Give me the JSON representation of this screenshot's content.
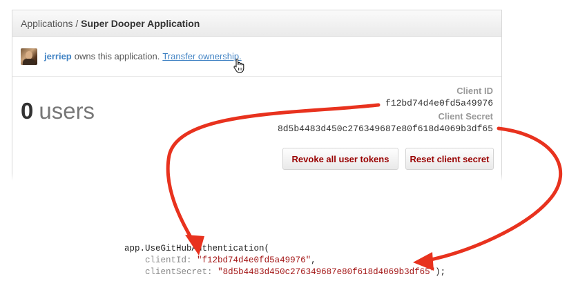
{
  "breadcrumb": {
    "parent": "Applications",
    "separator": "/",
    "current": "Super Dooper Application"
  },
  "owner": {
    "username": "jerriep",
    "text": "owns this application.",
    "link": "Transfer ownership."
  },
  "stats": {
    "count": "0",
    "unit": "users"
  },
  "credentials": {
    "client_id_label": "Client ID",
    "client_id": "f12bd74d4e0fd5a49976",
    "client_secret_label": "Client Secret",
    "client_secret": "8d5b4483d450c276349687e80f618d4069b3df65"
  },
  "buttons": {
    "revoke": "Revoke all user tokens",
    "reset": "Reset client secret"
  },
  "code": {
    "line1": "app.UseGitHubAuthentication(",
    "client_id_key": "clientId:",
    "client_id_value": "\"f12bd74d4e0fd5a49976\"",
    "client_id_end": ",",
    "client_secret_key": "clientSecret:",
    "client_secret_value": "\"8d5b4483d450c276349687e80f618d4069b3df65\"",
    "client_secret_end": ");"
  },
  "colors": {
    "accent_link": "#4183c4",
    "danger_text": "#990000",
    "annotation_arrow": "#e8321e"
  },
  "icons": [
    "avatar",
    "hand-pointer-icon",
    "annotation-arrow"
  ]
}
